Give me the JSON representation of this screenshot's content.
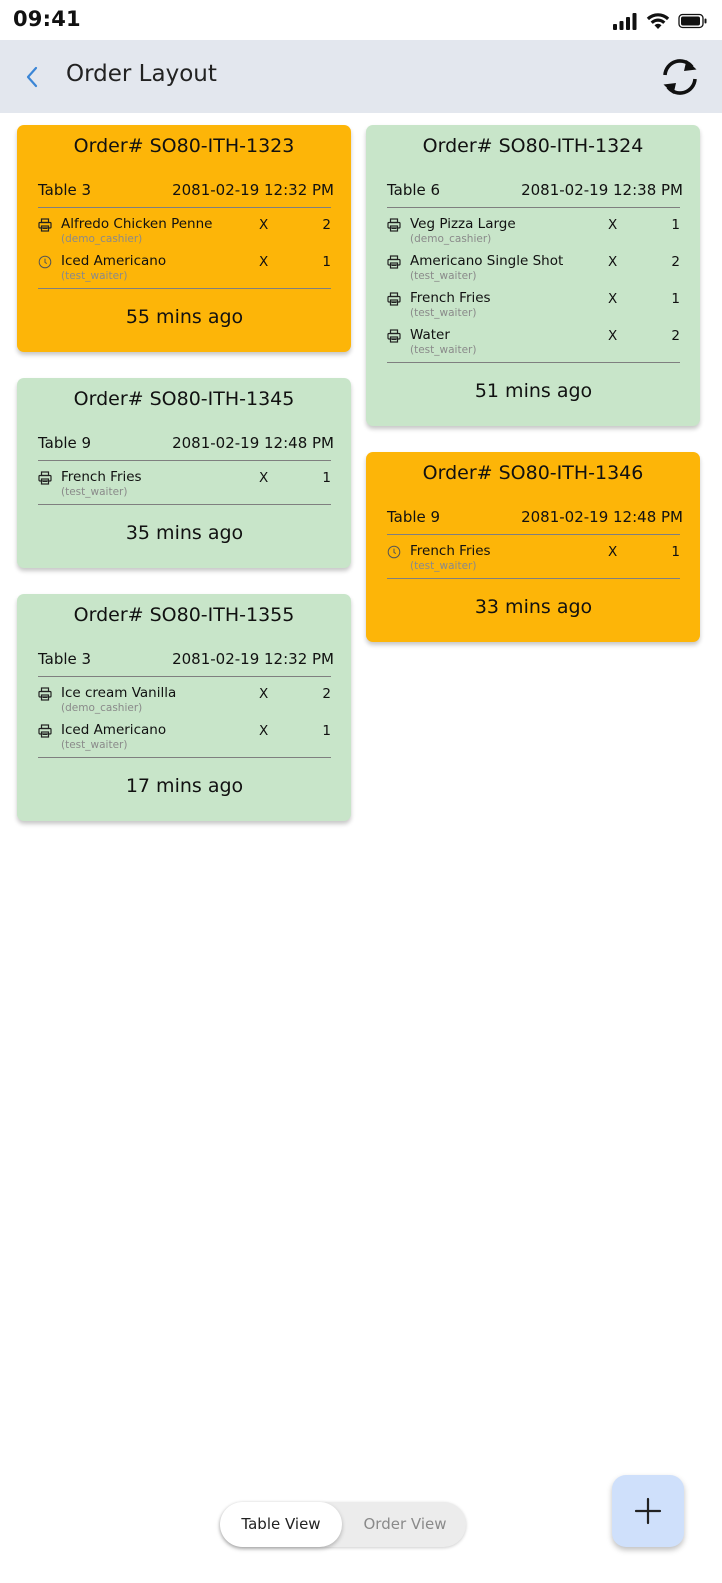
{
  "status_bar": {
    "time": "09:41"
  },
  "header": {
    "title": "Order Layout"
  },
  "columns": {
    "left": [
      {
        "title": "Order# SO80-ITH-1323",
        "table": "Table 3",
        "datetime": "2081-02-19 12:32 PM",
        "color": "#fdb508",
        "items": [
          {
            "icon": "printer-icon",
            "name": "Alfredo Chicken Penne",
            "user": "(demo_cashier)",
            "x": "X",
            "qty": "2"
          },
          {
            "icon": "clock-icon",
            "name": "Iced Americano",
            "user": "(test_waiter)",
            "x": "X",
            "qty": "1"
          }
        ],
        "elapsed": "55 mins ago"
      },
      {
        "title": "Order# SO80-ITH-1345",
        "table": "Table 9",
        "datetime": "2081-02-19 12:48 PM",
        "color": "#c8e5c9",
        "items": [
          {
            "icon": "printer-icon",
            "name": "French Fries",
            "user": "(test_waiter)",
            "x": "X",
            "qty": "1"
          }
        ],
        "elapsed": "35 mins ago"
      },
      {
        "title": "Order# SO80-ITH-1355",
        "table": "Table 3",
        "datetime": "2081-02-19 12:32 PM",
        "color": "#c8e5c9",
        "items": [
          {
            "icon": "printer-icon",
            "name": "Ice cream Vanilla",
            "user": "(demo_cashier)",
            "x": "X",
            "qty": "2"
          },
          {
            "icon": "printer-icon",
            "name": "Iced Americano",
            "user": "(test_waiter)",
            "x": "X",
            "qty": "1"
          }
        ],
        "elapsed": "17 mins ago"
      }
    ],
    "right": [
      {
        "title": "Order# SO80-ITH-1324",
        "table": "Table 6",
        "datetime": "2081-02-19 12:38 PM",
        "color": "#c8e5c9",
        "items": [
          {
            "icon": "printer-icon",
            "name": "Veg Pizza Large",
            "user": "(demo_cashier)",
            "x": "X",
            "qty": "1"
          },
          {
            "icon": "printer-icon",
            "name": "Americano Single Shot",
            "user": "(test_waiter)",
            "x": "X",
            "qty": "2"
          },
          {
            "icon": "printer-icon",
            "name": "French Fries",
            "user": "(test_waiter)",
            "x": "X",
            "qty": "1"
          },
          {
            "icon": "printer-icon",
            "name": "Water",
            "user": "(test_waiter)",
            "x": "X",
            "qty": "2"
          }
        ],
        "elapsed": "51 mins ago"
      },
      {
        "title": "Order# SO80-ITH-1346",
        "table": "Table 9",
        "datetime": "2081-02-19 12:48 PM",
        "color": "#fdb508",
        "items": [
          {
            "icon": "clock-icon",
            "name": "French Fries",
            "user": "(test_waiter)",
            "x": "X",
            "qty": "1"
          }
        ],
        "elapsed": "33 mins ago"
      }
    ]
  },
  "view_toggle": {
    "active": "Table View",
    "inactive": "Order View"
  },
  "fab": {
    "icon": "plus-icon"
  }
}
